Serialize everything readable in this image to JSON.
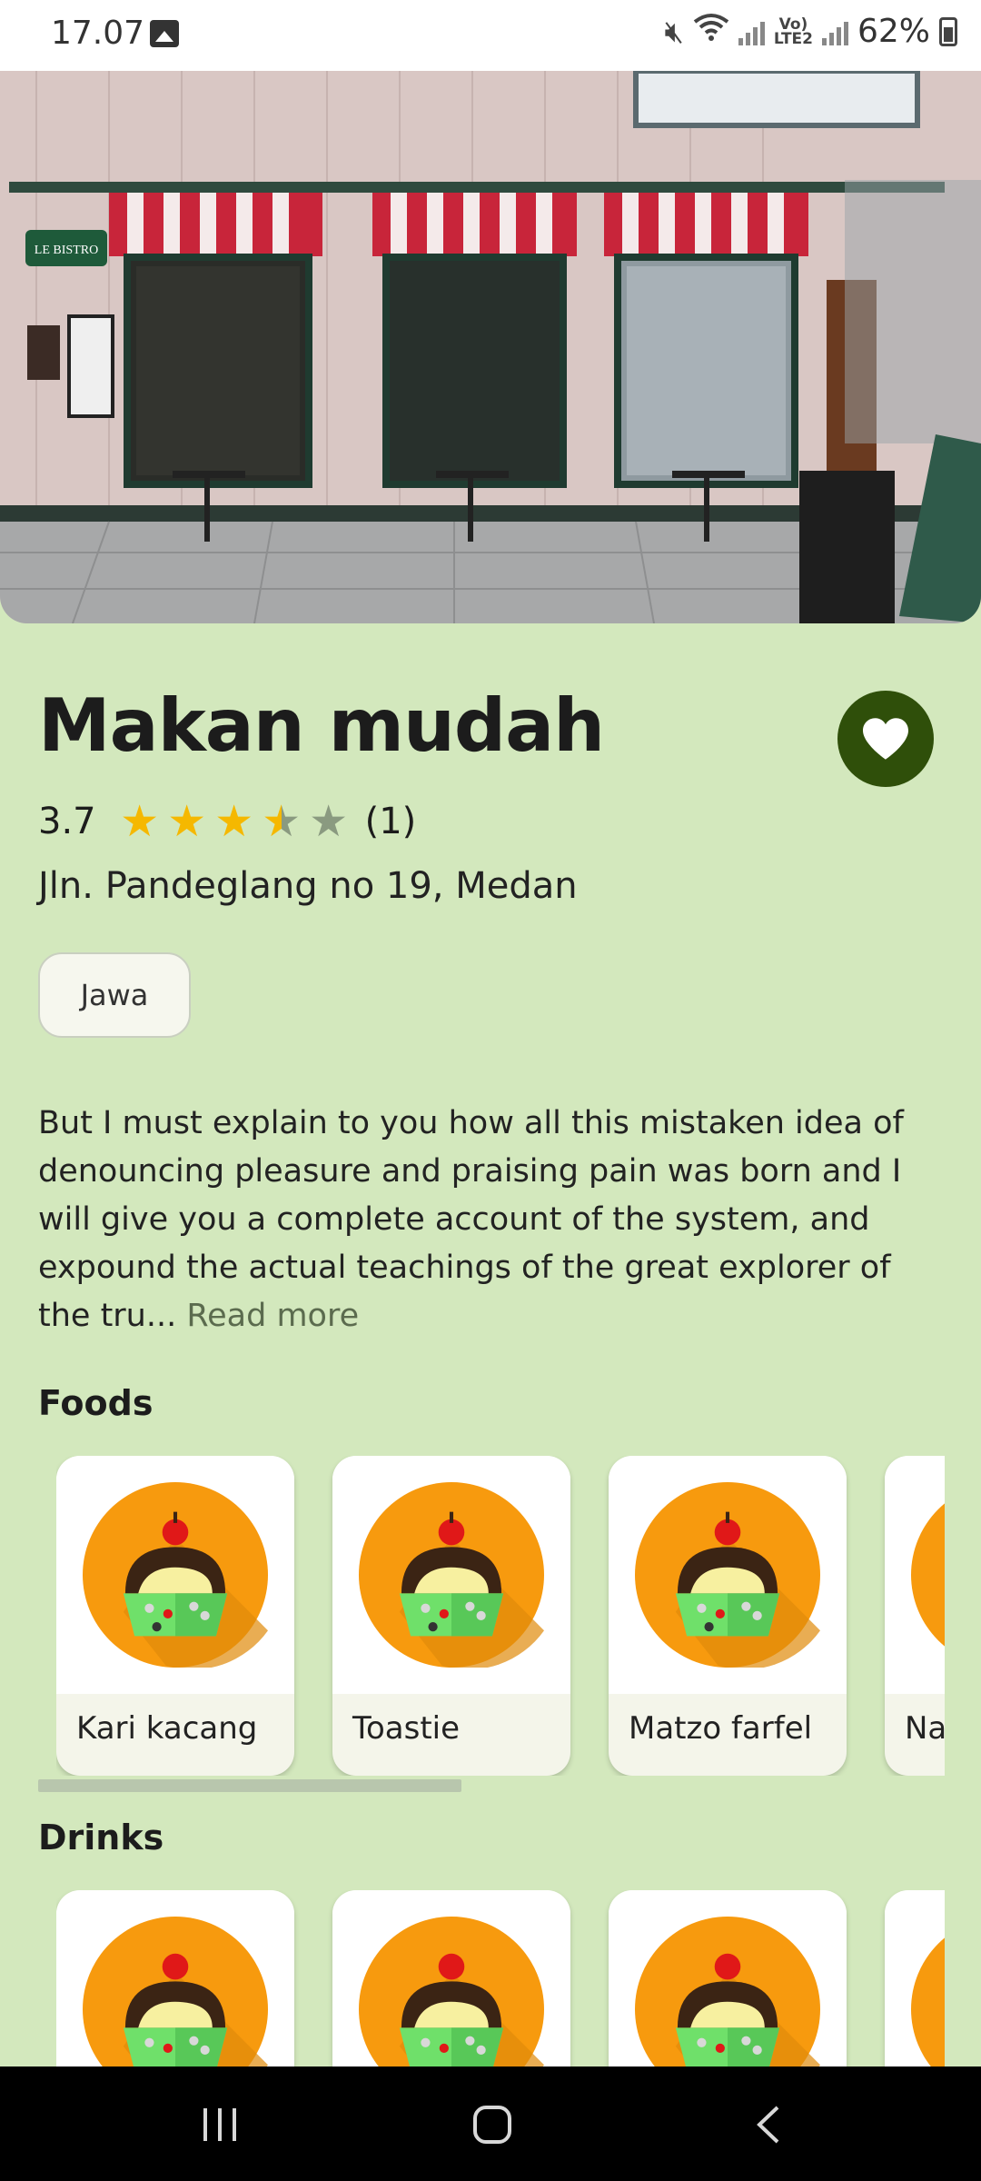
{
  "status_bar": {
    "time": "17.07",
    "network_label": "Vo)\nLTE2",
    "battery": "62%"
  },
  "place": {
    "name": "Makan mudah",
    "rating": "3.7",
    "rating_value": 3.7,
    "review_count": "(1)",
    "address": "Jln. Pandeglang no 19, Medan",
    "category": "Jawa",
    "description": "But I must explain to you how all this mistaken idea of denouncing pleasure and praising pain was born and I will give you a complete account of the system, and expound the actual teachings of the great explorer of the tru...",
    "read_more": "Read more"
  },
  "hero_sign": "LE BISTRO",
  "sections": {
    "foods_title": "Foods",
    "drinks_title": "Drinks"
  },
  "foods": [
    {
      "name": "Kari kacang"
    },
    {
      "name": "Toastie"
    },
    {
      "name": "Matzo farfel"
    },
    {
      "name": "Na"
    }
  ],
  "drinks": [
    {
      "name": ""
    },
    {
      "name": ""
    },
    {
      "name": ""
    },
    {
      "name": ""
    }
  ],
  "colors": {
    "background": "#d3e8bd",
    "accent": "#2f4f0a",
    "star": "#f5b800",
    "star_empty": "#8a9a80",
    "food_circle": "#f79a0e"
  }
}
